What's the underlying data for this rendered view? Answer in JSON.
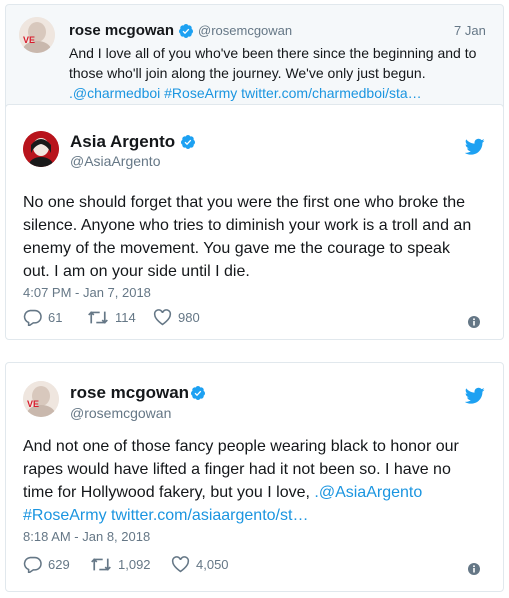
{
  "quoted": {
    "name": "rose mcgowan",
    "handle": "@rosemcgowan",
    "date": "7 Jan",
    "line1": "And I love all of you who've been there since the beginning and to",
    "line2": "those who'll join along the journey. We've only just begun.",
    "link_line": ".@charmedboi #RoseArmy twitter.com/charmedboi/sta…"
  },
  "asia": {
    "name": "Asia Argento",
    "handle": "@AsiaArgento",
    "text_lines": [
      "No one should forget that you were the first one who broke the",
      "silence. Anyone who tries to diminish your work is a troll and an",
      "enemy of the movement. You gave me the courage to speak",
      "out. I am on your side until I die."
    ],
    "timestamp": "4:07 PM - Jan 7, 2018",
    "replies": "61",
    "retweets": "114",
    "likes": "980"
  },
  "rose": {
    "name": "rose mcgowan",
    "handle": "@rosemcgowan",
    "text_line1": "And not one of those fancy people wearing black to honor our",
    "text_line2": "rapes would have lifted a finger had it not been so. I have no",
    "text_line3_plain": "time for Hollywood fakery, but you I love, ",
    "text_line3_link": ".@AsiaArgento",
    "text_line4_link": "#RoseArmy twitter.com/asiaargento/st…",
    "timestamp": "8:18 AM - Jan 8, 2018",
    "replies": "629",
    "retweets": "1,092",
    "likes": "4,050"
  },
  "colors": {
    "accent": "#1da1f2",
    "link": "#1b95e0",
    "muted": "#657786",
    "border": "#e1e8ed"
  },
  "icons": [
    "verified-badge-icon",
    "twitter-bird-icon",
    "reply-icon",
    "retweet-icon",
    "like-icon",
    "info-icon"
  ]
}
